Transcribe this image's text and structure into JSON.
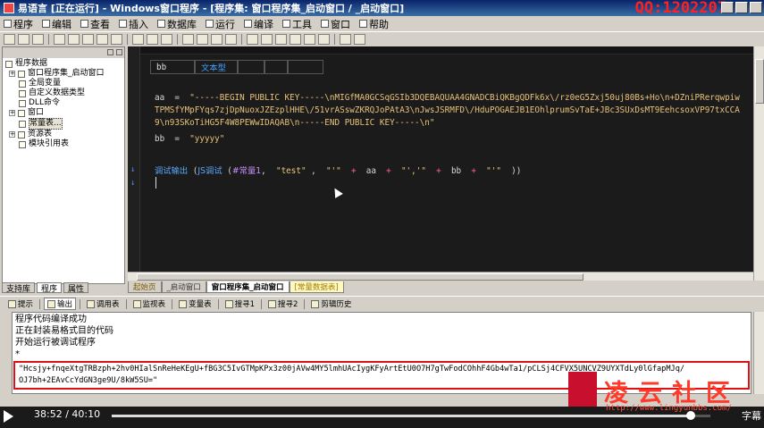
{
  "window": {
    "title": "易语言 [正在运行] - Windows窗口程序 - [程序集: 窗口程序集_启动窗口 / _启动窗口]",
    "watermark": "QQ:1202207"
  },
  "menu": [
    "程序",
    "编辑",
    "查看",
    "插入",
    "数据库",
    "运行",
    "编译",
    "工具",
    "窗口",
    "帮助"
  ],
  "tree": {
    "root": "程序数据",
    "items": [
      "窗口程序集_启动窗口",
      "全局变量",
      "自定义数据类型",
      "DLL命令",
      "窗口",
      "常量表...",
      "资源表",
      "模块引用表"
    ]
  },
  "left_tabs": [
    "支持库",
    "程序",
    "属性"
  ],
  "editor": {
    "var_name": "bb",
    "var_type": "文本型",
    "line_aa_lhs": "aa  =  ",
    "line_aa_str": "\"-----BEGIN PUBLIC KEY-----\\nMIGfMA0GCSqGSIb3DQEBAQUAA4GNADCBiQKBgQDFk6x\\/rz0eG5Zxj50uj80Bs+Ho\\n+DZniPRerqwpiw",
    "line_aa_str2": "TPMSfYMpFYqs7zjDpNuoxJZEzplHHE\\/51vrASswZKRQJoPAtA3\\nJwsJSRMFD\\/HduPOGAEJB1EOhlprumSvTaE+JBc3SUxDsMT9EehcsoxVP97txCCA",
    "line_aa_str3": "9\\n93SKoTiHG5F4W8PEWwIDAQAB\\n-----END PUBLIC KEY-----\\n\"",
    "line_bb_lhs": "bb  =  ",
    "line_bb_str": "\"yyyyy\"",
    "call_func": "调试输出",
    "call_open": " (",
    "call_js": "JS调试",
    "call_args_open": " (",
    "call_const": "#常量1",
    "call_rest1": ",  ",
    "call_test": "\"test\"",
    "call_rest2": " ,  ",
    "call_q1": "\"'\"",
    "call_plus1": "  +  ",
    "call_aa": "aa",
    "call_plus2": "  +  ",
    "call_q2": "\"','\"",
    "call_plus3": "  +  ",
    "call_bb": "bb",
    "call_plus4": "  +  ",
    "call_q3": "\"'\"",
    "call_close": "  ))"
  },
  "editor_tabs": [
    "起始页",
    "_启动窗口",
    "窗口程序集_启动窗口",
    "[常量数据表]"
  ],
  "output_tabs": [
    "提示",
    "输出",
    "调用表",
    "监视表",
    "变量表",
    "搜寻1",
    "搜寻2",
    "剪辑历史"
  ],
  "output": {
    "lines": [
      "程序代码编译成功",
      "正在封装易格式目的代码",
      "开始运行被调试程序",
      "*"
    ],
    "result_line1": "\"Hcsjy+fnqeXtgTRBzph+2hv0HIalSnReHeKEgU+fBG3C5IvGTMpKPx3z00jAVw4MY5lmhUAcIygKFyArtEtU0O7H7gTwFodCOhhF4Gb4wTa1/pCLSj4CFVX5UNCVZ9UYXTdLy0lGfapMJq/",
    "result_line2": "OJ7bh+2EAvCcYdGN3ge9U/8kW5SU=\""
  },
  "site_logo": {
    "name": "凌云社区",
    "url": "http://www.lingyunbbs.com/"
  },
  "player": {
    "current_time": "38:52",
    "total_time": "40:10",
    "progress": 0.9676,
    "subtitle_label": "字幕"
  },
  "colors": {
    "editor_bg": "#1b1b1b",
    "string": "#e8c27a",
    "operator": "#ff5fa0",
    "keyword": "#5aa9ff",
    "highlight_box": "#e01010"
  }
}
